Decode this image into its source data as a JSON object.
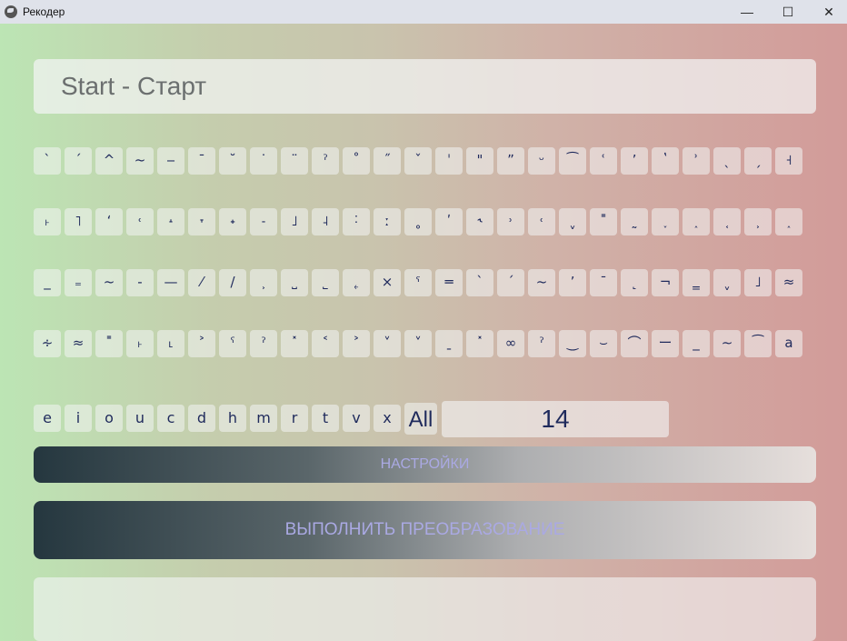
{
  "window": {
    "title": "Рекодер",
    "min_glyph": "—",
    "max_glyph": "☐",
    "close_glyph": "✕"
  },
  "start_field": {
    "value": "Start - Старт"
  },
  "keyboard": {
    "rows": [
      [
        "`",
        "´",
        "^",
        "~",
        "‒",
        "¯",
        "˘",
        "˙",
        "¨",
        "ˀ",
        "˚",
        "˝",
        "ˇ",
        "ˈ",
        "\"",
        "ˮ",
        "ᵕ",
        "⁀",
        "ʿ",
        "ʼ",
        "ʽ",
        "ʾ",
        "ˎ",
        "ˏ",
        "˧"
      ],
      [
        "˫",
        "˥",
        "ʻ",
        "˓",
        "˔",
        "˕",
        "˖",
        "˗",
        "˩",
        "˨",
        "˸",
        "ː",
        "˳",
        "ʹ",
        "˞",
        "˒",
        "˓",
        "ˬ",
        "˭",
        "˷",
        "˯",
        "˰",
        "˱",
        "˲",
        "˰"
      ],
      [
        "_",
        "₌",
        "~",
        "-",
        "—",
        "⁄",
        "/",
        "˲",
        "˽",
        "˾",
        "˿",
        "×",
        "ˤ",
        "═",
        "`",
        "ˊ",
        "~",
        "ʼ",
        "ˉ",
        "˻",
        "¬",
        "‗",
        "ˬ",
        "˩",
        "≈"
      ],
      [
        "∻",
        "≈",
        "˭",
        "˫",
        "˪",
        "˃",
        "ˁ",
        "ˀ",
        "˟",
        "˂",
        "˃",
        "˅",
        "˅",
        "ˍ",
        "˟",
        "∞",
        "ˀ",
        "‿",
        "⌣",
        "⌒",
        "ー",
        "_",
        "∼",
        "⁀",
        "a"
      ]
    ],
    "letters": [
      "e",
      "i",
      "o",
      "u",
      "c",
      "d",
      "h",
      "m",
      "r",
      "t",
      "v",
      "x"
    ],
    "all_label": "All"
  },
  "count_field": {
    "value": "14"
  },
  "settings_button": {
    "label": "НАСТРОЙКИ"
  },
  "run_button": {
    "label": "ВЫПОЛНИТЬ ПРЕОБРАЗОВАНИЕ"
  },
  "output_field": {
    "value": ""
  }
}
